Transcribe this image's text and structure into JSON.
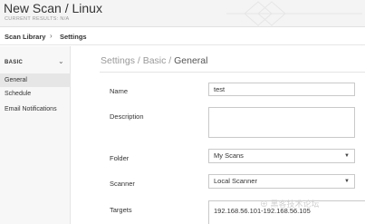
{
  "header": {
    "title": "New Scan / Linux",
    "subtitle": "CURRENT RESULTS: N/A"
  },
  "breadcrumb": {
    "items": [
      "Scan Library",
      "Settings"
    ],
    "separator": "›"
  },
  "sidebar": {
    "section": "BASIC",
    "items": [
      {
        "label": "General",
        "active": true
      },
      {
        "label": "Schedule",
        "active": false
      },
      {
        "label": "Email Notifications",
        "active": false
      }
    ]
  },
  "main": {
    "path_prefix": "Settings / Basic / ",
    "path_current": "General",
    "fields": {
      "name": {
        "label": "Name",
        "value": "test"
      },
      "description": {
        "label": "Description",
        "value": ""
      },
      "folder": {
        "label": "Folder",
        "value": "My Scans"
      },
      "scanner": {
        "label": "Scanner",
        "value": "Local Scanner"
      },
      "targets": {
        "label": "Targets",
        "value": "192.168.56.101-192.168.56.105"
      }
    }
  },
  "watermark": "⊕ 黑客技术论坛"
}
